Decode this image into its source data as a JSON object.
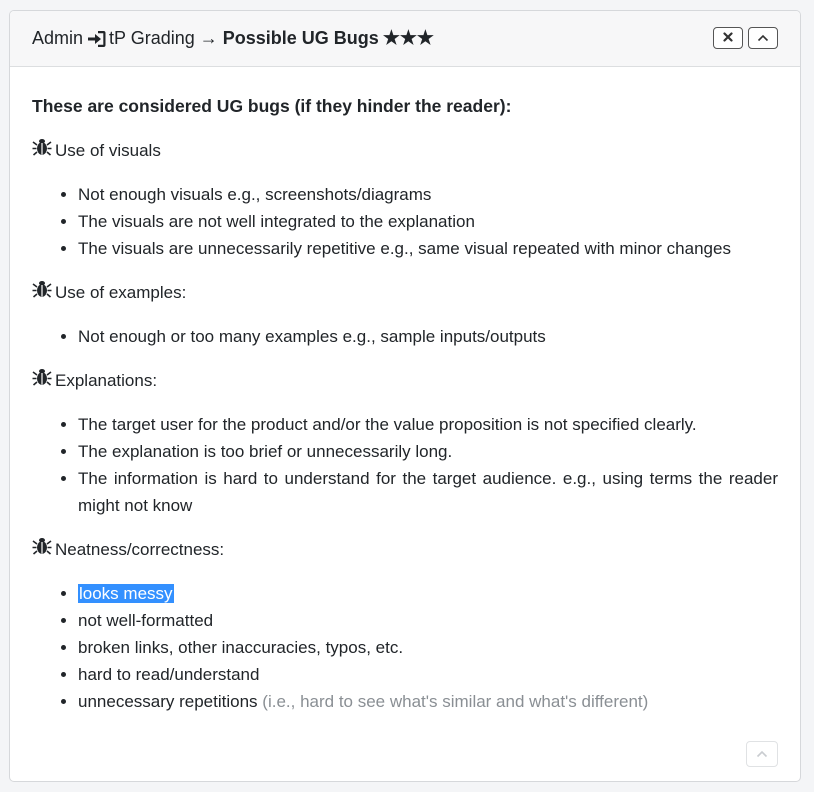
{
  "header": {
    "crumb_admin": "Admin",
    "crumb_tp_grading": "tP Grading",
    "arrow": "→",
    "title": "Possible UG Bugs",
    "stars": "★★★",
    "close_label": "×",
    "collapse_label": "^"
  },
  "body": {
    "lead": "These are considered UG bugs (if they hinder the reader):",
    "sections": [
      {
        "title": "Use of visuals",
        "items": [
          "Not enough visuals e.g., screenshots/diagrams",
          "The visuals are not well integrated to the explanation",
          "The visuals are unnecessarily repetitive e.g., same visual repeated with minor changes"
        ]
      },
      {
        "title": "Use of examples:",
        "items": [
          "Not enough or too many examples e.g., sample inputs/outputs"
        ]
      },
      {
        "title": "Explanations:",
        "items": [
          "The target user for the product and/or the value proposition is not specified clearly.",
          "The explanation is too brief or unnecessarily long.",
          "The information is hard to understand for the target audience. e.g., using terms the reader might not know"
        ]
      },
      {
        "title": "Neatness/correctness:",
        "items": [
          "looks messy",
          "not well-formatted",
          "broken links, other inaccuracies, typos, etc.",
          "hard to read/understand",
          "unnecessary repetitions"
        ],
        "last_item_note": "(i.e., hard to see what's similar and what's different)"
      }
    ]
  },
  "icons": {
    "breadcrumb_separator": "sign-in-icon",
    "section_icon": "bug-icon",
    "header_close": "close-icon",
    "header_collapse": "chevron-up-icon",
    "footer_collapse": "chevron-up-icon"
  },
  "colors": {
    "selection": "#3390ff",
    "muted_text": "#8a8f94",
    "header_bg": "#f7f7f8"
  }
}
